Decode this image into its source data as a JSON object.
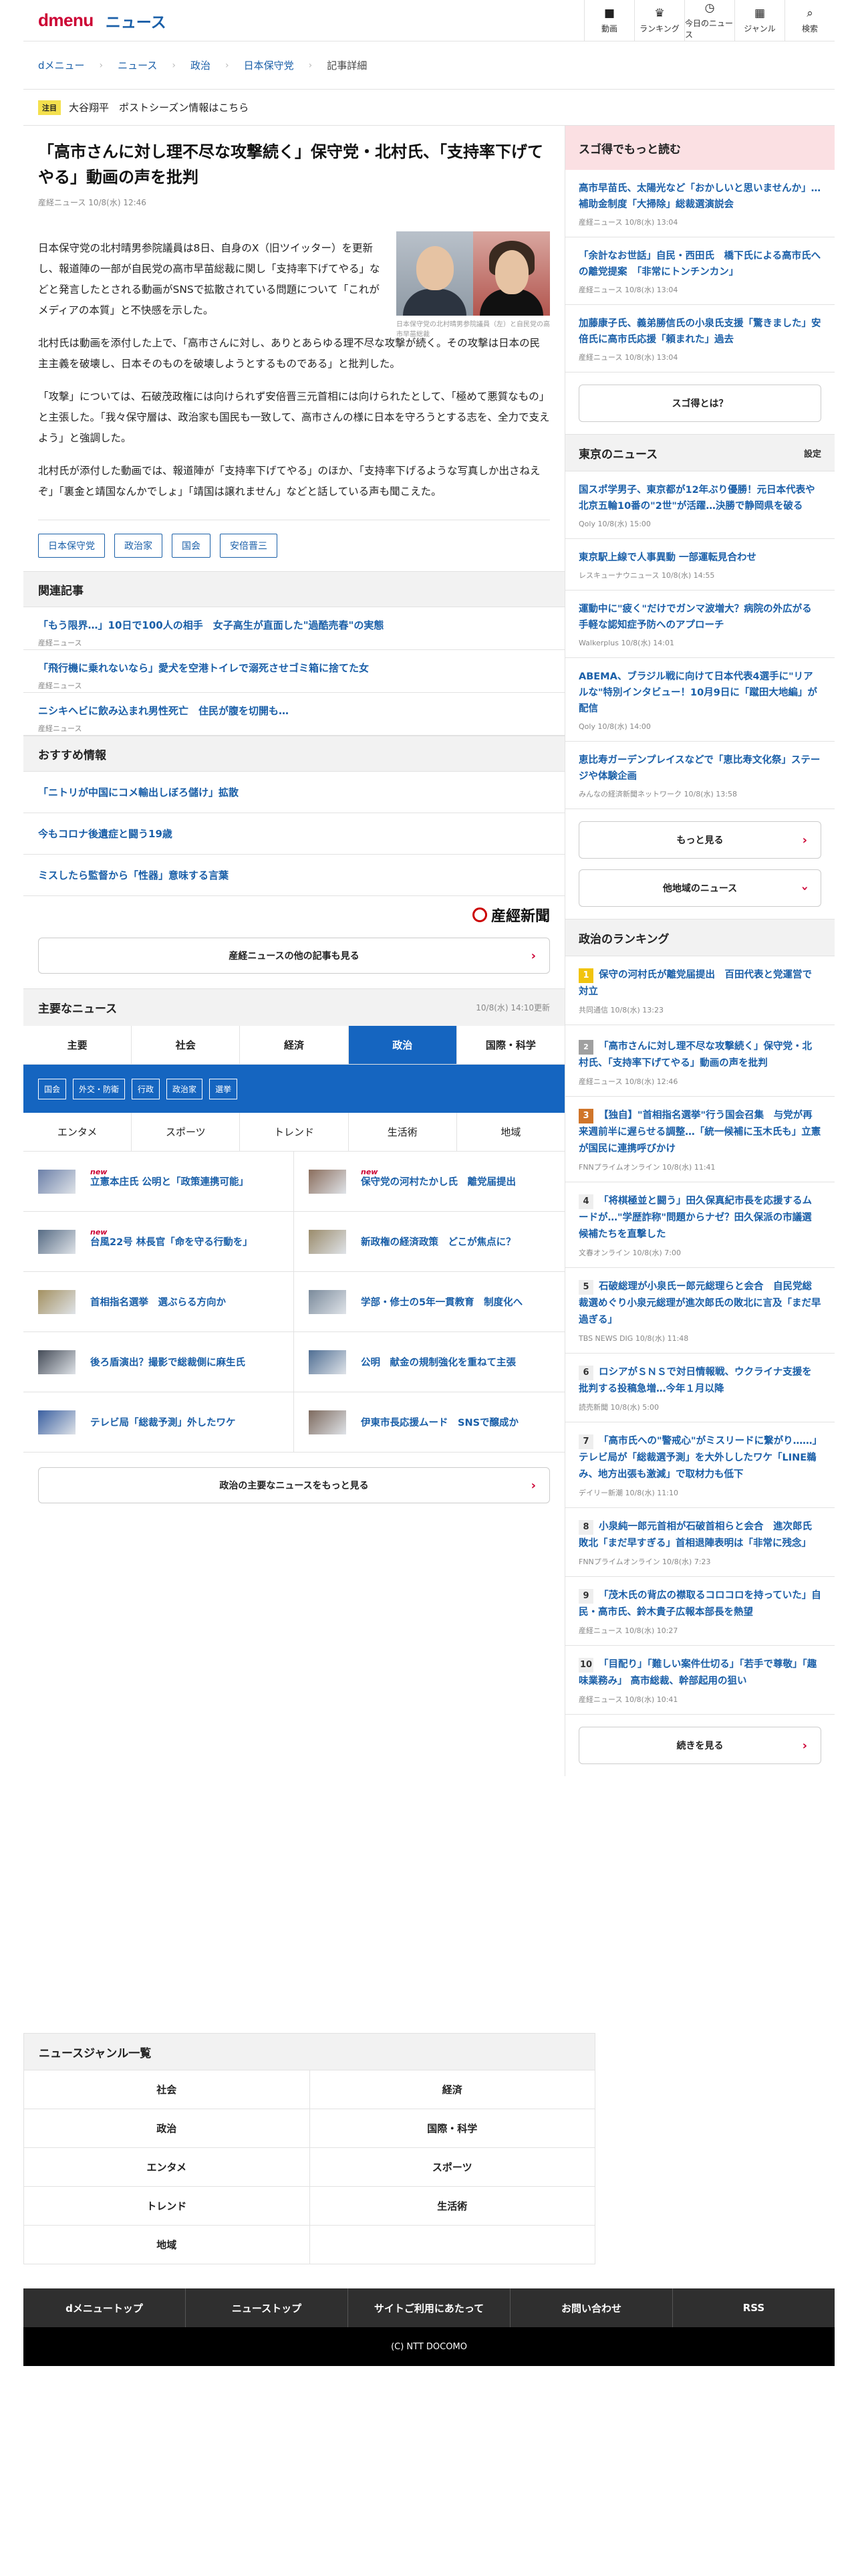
{
  "header": {
    "logo_dmenu": "dmenu",
    "logo_news": "ニュース",
    "nav": [
      {
        "label": "動画",
        "icon": "video-icon",
        "glyph": "■"
      },
      {
        "label": "ランキング",
        "icon": "trophy-icon",
        "glyph": "♛"
      },
      {
        "label": "今日のニュース",
        "icon": "clock-icon",
        "glyph": "◷"
      },
      {
        "label": "ジャンル",
        "icon": "grid-icon",
        "glyph": "▦"
      },
      {
        "label": "検索",
        "icon": "search-icon",
        "glyph": "⌕"
      }
    ]
  },
  "breadcrumb": [
    "dメニュー",
    "ニュース",
    "政治",
    "日本保守党",
    "記事詳細"
  ],
  "notice": {
    "tag": "注目",
    "text": "大谷翔平　ポストシーズン情報はこちら"
  },
  "article": {
    "title": "「高市さんに対し理不尽な攻撃続く」保守党・北村氏、「支持率下げてやる」動画の声を批判",
    "meta": "産経ニュース 10/8(水) 12:46",
    "photo_caption": "日本保守党の北村晴男参院議員（左）と自民党の高市早苗総裁",
    "paragraphs": [
      "日本保守党の北村晴男参院議員は8日、自身のX（旧ツイッター）を更新し、報道陣の一部が自民党の高市早苗総裁に関し「支持率下げてやる」などと発言したとされる動画がSNSで拡散されている問題について「これがメディアの本質」と不快感を示した。",
      "北村氏は動画を添付した上で、「高市さんに対し、ありとあらゆる理不尽な攻撃が続く。その攻撃は日本の民主主義を破壊し、日本そのものを破壊しようとするものである」と批判した。",
      "「攻撃」については、石破茂政権には向けられず安倍晋三元首相には向けられたとして、「極めて悪質なもの」と主張した。「我々保守層は、政治家も国民も一致して、高市さんの様に日本を守ろうとする志を、全力で支えよう」と強調した。",
      "北村氏が添付した動画では、報道陣が「支持率下げてやる」のほか、「支持率下げるような写真しか出さねえぞ」「裏金と靖国なんかでしょ」「靖国は譲れません」などと話している声も聞こえた。"
    ],
    "tags": [
      "日本保守党",
      "政治家",
      "国会",
      "安倍晋三"
    ]
  },
  "related": {
    "heading": "関連記事",
    "items": [
      {
        "title": "「もう限界…」10日で100人の相手　女子高生が直面した\"過酷売春\"の実態",
        "source": "産経ニュース"
      },
      {
        "title": "「飛行機に乗れないなら」愛犬を空港トイレで溺死させゴミ箱に捨てた女",
        "source": "産経ニュース"
      },
      {
        "title": "ニシキヘビに飲み込まれ男性死亡　住民が腹を切開も…",
        "source": "産経ニュース"
      }
    ]
  },
  "recommend": {
    "heading": "おすすめ情報",
    "items": [
      "「ニトリが中国にコメ輸出しぼろ儲け」拡散",
      "今もコロナ後遺症と闘う19歳",
      "ミスしたら監督から「性器」意味する言葉"
    ]
  },
  "sankei": {
    "logo": "産經新聞",
    "more_label": "産経ニュースの他の記事も見る"
  },
  "major": {
    "heading": "主要なニュース",
    "date": "10/8(水) 14:10更新",
    "tabs": [
      "主要",
      "社会",
      "経済",
      "政治",
      "国際・科学"
    ],
    "subtabs": [
      "国会",
      "外交・防衛",
      "行政",
      "政治家",
      "選挙"
    ],
    "tabs2": [
      "エンタメ",
      "スポーツ",
      "トレンド",
      "生活術",
      "地域"
    ],
    "new_label": "new",
    "items": [
      {
        "title": "立憲本庄氏 公明と「政策連携可能」",
        "new": true,
        "thumb": "#6b7fa8"
      },
      {
        "title": "保守党の河村たかし氏　離党届提出",
        "new": true,
        "thumb": "#8a6d5c"
      },
      {
        "title": "台風22号 林長官「命を守る行動を」",
        "new": true,
        "thumb": "#566b84"
      },
      {
        "title": "新政権の経済政策　どこが焦点に？",
        "new": false,
        "thumb": "#9a8b6b"
      },
      {
        "title": "首相指名選挙　選ぶらる方向か",
        "new": false,
        "thumb": "#a39060"
      },
      {
        "title": "学部・修士の5年一貫教育　制度化へ",
        "new": false,
        "thumb": "#7a8a9b"
      },
      {
        "title": "後ろ盾演出？撮影で総裁側に麻生氏",
        "new": false,
        "thumb": "#444b57"
      },
      {
        "title": "公明　献金の規制強化を重ねて主張",
        "new": false,
        "thumb": "#4f6e93"
      },
      {
        "title": "テレビ局「総裁予測」外したワケ",
        "new": false,
        "thumb": "#3a5fa0"
      },
      {
        "title": "伊東市長応援ムード　SNSで醸成か",
        "new": false,
        "thumb": "#7d6a5e"
      }
    ],
    "more_label": "政治の主要なニュースをもっと見る"
  },
  "sidebar": {
    "sugotoku": {
      "heading": "スゴ得でもっと読む",
      "items": [
        {
          "title": "高市早苗氏、太陽光など「おかしいと思いませんか」…補助金制度「大掃除」総裁選演説会",
          "source": "産経ニュース 10/8(水) 13:04"
        },
        {
          "title": "「余計なお世話」自民・西田氏　橋下氏による高市氏への離党提案　「非常にトンチンカン」",
          "source": "産経ニュース 10/8(水) 13:04"
        },
        {
          "title": "加藤康子氏、義弟勝信氏の小泉氏支援「驚きました」安倍氏に高市氏応援「頼まれた」過去",
          "source": "産経ニュース 10/8(水) 13:04"
        }
      ],
      "button": "スゴ得とは？"
    },
    "tokyo": {
      "heading": "東京のニュース",
      "setting": "設定",
      "items": [
        {
          "title": "国スポ学男子、東京都が12年ぶり優勝！元日本代表や北京五輪10番の\"2世\"が活躍…決勝で静岡県を破る",
          "source": "Qoly 10/8(水) 15:00"
        },
        {
          "title": "東京駅上線で人事異動 一部運転見合わせ",
          "source": "レスキューナウニュース 10/8(水) 14:55"
        },
        {
          "title": "運動中に\"疲く\"だけでガンマ波増大？病院の外広がる手軽な認知症予防へのアプローチ",
          "source": "Walkerplus 10/8(水) 14:01"
        },
        {
          "title": "ABEMA、ブラジル戦に向けて日本代表4選手に\"リアルな\"特別インタビュー！10月9日に「蹴田大地編」が配信",
          "source": "Qoly 10/8(水) 14:00"
        },
        {
          "title": "恵比寿ガーデンプレイスなどで「恵比寿文化祭」ステージや体験企画",
          "source": "みんなの経済新聞ネットワーク 10/8(水) 13:58"
        }
      ],
      "more_button": "もっと見る",
      "other_button": "他地域のニュース"
    },
    "ranking": {
      "heading": "政治のランキング",
      "items": [
        {
          "rank": "1",
          "title": "保守の河村氏が離党届提出　百田代表と党運営で対立",
          "source": "共同通信 10/8(水) 13:23",
          "medal": "g"
        },
        {
          "rank": "2",
          "title": "「高市さんに対し理不尽な攻撃続く」保守党・北村氏、「支持率下げてやる」動画の声を批判",
          "source": "産経ニュース 10/8(水) 12:46",
          "medal": "s"
        },
        {
          "rank": "3",
          "title": "【独自】\"首相指名選挙\"行う国会召集　与党が再来週前半に遅らせる調整…「統一候補に玉木氏も」立憲が国民に連携呼びかけ",
          "source": "FNNプライムオンライン 10/8(水) 11:41",
          "medal": "b"
        },
        {
          "rank": "4",
          "title": "「将棋極並と闘う」田久保真紀市長を応援するムードが…\"学歴詐称\"問題からナゼ？田久保派の市議選候補たちを直撃した",
          "source": "文春オンライン 10/8(水) 7:00",
          "medal": ""
        },
        {
          "rank": "5",
          "title": "石破総理が小泉氏ー郎元総理らと会合　自民党総裁選めぐり小泉元総理が進次郎氏の敗北に言及「まだ早過ぎる」",
          "source": "TBS NEWS DIG 10/8(水) 11:48",
          "medal": ""
        },
        {
          "rank": "6",
          "title": "ロシアがＳＮＳで対日情報戦、ウクライナ支援を批判する投稿急増…今年１月以降",
          "source": "読売新聞 10/8(水) 5:00",
          "medal": ""
        },
        {
          "rank": "7",
          "title": "「高市氏への\"警戒心\"がミスリードに繋がり……」テレビ局が「総裁選予測」を大外ししたワケ「LINE鵜み、地方出張も激減」で取材力も低下",
          "source": "デイリー新潮 10/8(水) 11:10",
          "medal": ""
        },
        {
          "rank": "8",
          "title": "小泉純一郎元首相が石破首相らと会合　進次郎氏敗北「まだ早すぎる」首相退陣表明は「非常に残念」",
          "source": "FNNプライムオンライン 10/8(水) 7:23",
          "medal": ""
        },
        {
          "rank": "9",
          "title": "「茂木氏の背広の襟取るコロコロを持っていた」自民・高市氏、鈴木貴子広報本部長を熱望",
          "source": "産経ニュース 10/8(水) 10:27",
          "medal": ""
        },
        {
          "rank": "10",
          "title": "「目配り」「難しい案件仕切る」「若手で尊敬」「趣味業務み」 高市総裁、幹部起用の狙い",
          "source": "産経ニュース 10/8(水) 10:41",
          "medal": ""
        }
      ],
      "more_button": "続きを見る"
    }
  },
  "genre": {
    "heading": "ニュースジャンル一覧",
    "items": [
      "社会",
      "経済",
      "政治",
      "国際・科学",
      "エンタメ",
      "スポーツ",
      "トレンド",
      "生活術",
      "地域",
      ""
    ]
  },
  "footer": {
    "nav": [
      "dメニュートップ",
      "ニューストップ",
      "サイトご利用にあたって",
      "お問い合わせ",
      "RSS"
    ],
    "copyright": "(C) NTT DOCOMO"
  },
  "colors": {
    "brand": "#cc0033",
    "link": "#1a5fa8",
    "tab_active": "#1565c0",
    "sugotoku_bg": "#fbe0e3"
  }
}
